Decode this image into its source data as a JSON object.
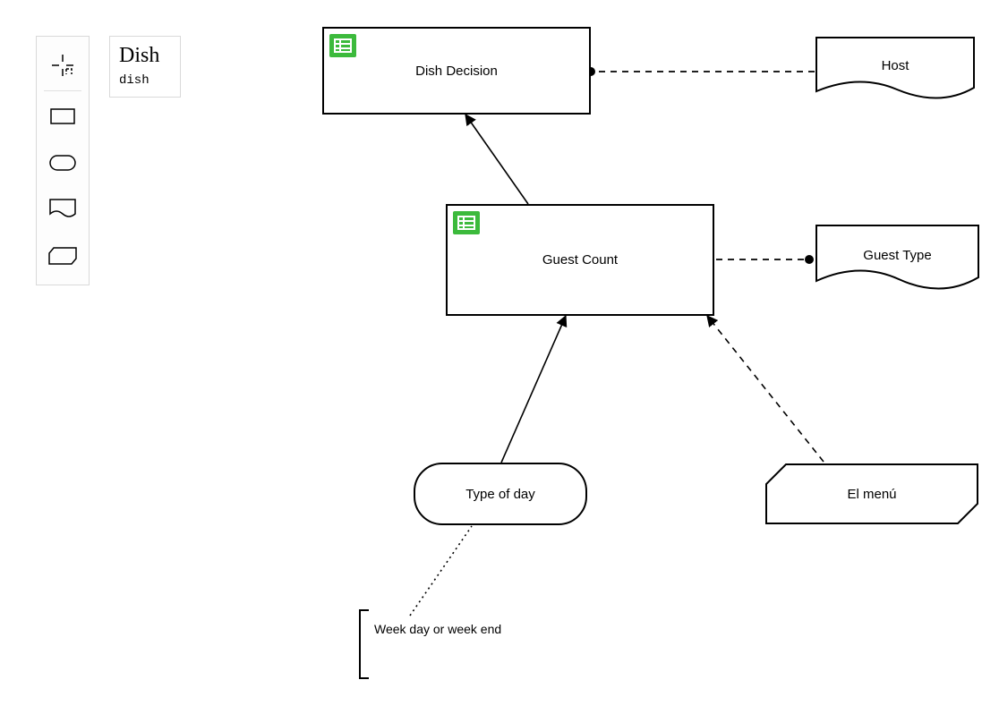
{
  "palette_card": {
    "title": "Dish",
    "subtitle": "dish"
  },
  "tools": {
    "select": "select-tool",
    "rectangle": "rectangle-tool",
    "rounded": "rounded-tool",
    "virtual": "virtual-tool",
    "hex": "hex-tool"
  },
  "nodes": {
    "dish_decision": {
      "label": "Dish Decision"
    },
    "guest_count": {
      "label": "Guest Count"
    },
    "host": {
      "label": "Host"
    },
    "guest_type": {
      "label": "Guest Type"
    },
    "type_of_day": {
      "label": "Type of day"
    },
    "el_menu": {
      "label": "El menú"
    }
  },
  "annotation": {
    "text": "Week day or week end"
  },
  "colors": {
    "badge_green": "#3cba3c",
    "stroke": "#000000"
  },
  "edges": [
    {
      "from": "guest_count",
      "to": "dish_decision",
      "style": "solid",
      "head": "arrow"
    },
    {
      "from": "host",
      "to": "dish_decision",
      "style": "dashed",
      "head": "dot"
    },
    {
      "from": "guest_type",
      "to": "guest_count",
      "style": "dashed",
      "head": "dot"
    },
    {
      "from": "type_of_day",
      "to": "guest_count",
      "style": "solid",
      "head": "arrow"
    },
    {
      "from": "el_menu",
      "to": "guest_count",
      "style": "dashed",
      "head": "arrow"
    },
    {
      "from": "annotation",
      "to": "type_of_day",
      "style": "dotted",
      "head": "none"
    }
  ]
}
